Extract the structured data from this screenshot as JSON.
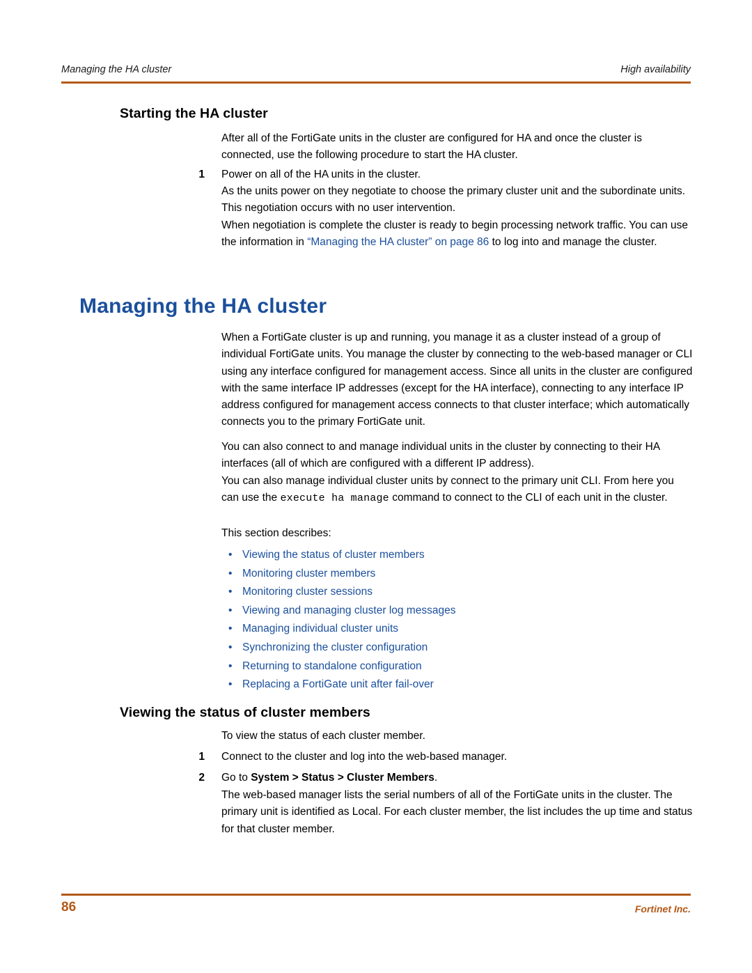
{
  "header": {
    "left": "Managing the HA cluster",
    "right": "High availability"
  },
  "sections": {
    "starting_heading": "Starting the HA cluster",
    "starting_intro": "After all of the FortiGate units in the cluster are configured for HA and once the cluster is connected, use the following procedure to start the HA cluster.",
    "step1_num": "1",
    "step1_text": "Power on all of the HA units in the cluster.",
    "step1_para": "As the units power on they negotiate to choose the primary cluster unit and the subordinate units. This negotiation occurs with no user intervention.",
    "negotiation_para_a": "When negotiation is complete the cluster is ready to begin processing network traffic. You can use the information in ",
    "negotiation_link": "“Managing the HA cluster” on page 86",
    "negotiation_para_b": " to log into and manage the cluster.",
    "managing_heading": "Managing the HA cluster",
    "managing_p1": "When a FortiGate cluster is up and running, you manage it as a cluster instead of a group of individual FortiGate units. You manage the cluster by connecting to the web-based manager or CLI using any interface configured for management access. Since all units in the cluster are configured with the same interface IP addresses (except for the HA interface), connecting to any interface IP address configured for management access connects to that cluster interface; which automatically connects you to the primary FortiGate unit.",
    "managing_p2": "You can also connect to and manage individual units in the cluster by connecting to their HA interfaces (all of which are configured with a different IP address).",
    "managing_p3_a": "You can also manage individual cluster units by connect to the primary unit CLI. From here you can use the ",
    "managing_p3_mono": "execute ha manage",
    "managing_p3_b": " command to connect to the CLI of each unit in the cluster.",
    "section_describes": "This section describes:",
    "bullets": [
      "Viewing the status of cluster members",
      "Monitoring cluster members",
      "Monitoring cluster sessions",
      "Viewing and managing cluster log messages",
      "Managing individual cluster units",
      "Synchronizing the cluster configuration",
      "Returning to standalone configuration",
      "Replacing a FortiGate unit after fail-over"
    ],
    "viewing_heading": "Viewing the status of cluster members",
    "viewing_intro": "To view the status of each cluster member.",
    "v_step1_num": "1",
    "v_step1_text": "Connect to the cluster and log into the web-based manager.",
    "v_step2_num": "2",
    "v_step2_prefix": "Go to ",
    "v_step2_bold": "System > Status > Cluster Members",
    "v_step2_suffix": ".",
    "viewing_last": "The web-based manager lists the serial numbers of all of the FortiGate units in the cluster. The primary unit is identified as Local. For each cluster member, the list includes the up time and status for that cluster member."
  },
  "footer": {
    "page_number": "86",
    "company": "Fortinet Inc."
  },
  "colors": {
    "accent_rule": "#b35a18",
    "heading_blue": "#1b4f9c",
    "link_blue": "#1b4f9c"
  }
}
